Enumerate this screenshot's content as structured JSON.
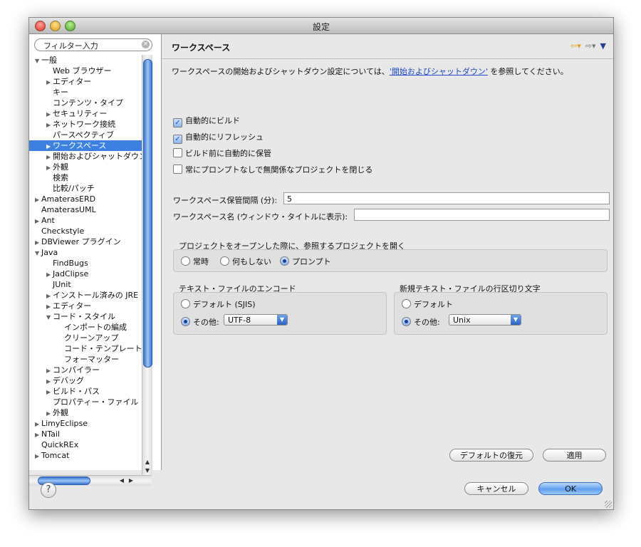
{
  "window": {
    "title": "設定"
  },
  "filter": {
    "placeholder": "フィルター入力"
  },
  "tree": [
    {
      "label": "一般",
      "indent": 0,
      "twisty": "open"
    },
    {
      "label": "Web ブラウザー",
      "indent": 1,
      "twisty": ""
    },
    {
      "label": "エディター",
      "indent": 1,
      "twisty": "closed"
    },
    {
      "label": "キー",
      "indent": 1,
      "twisty": ""
    },
    {
      "label": "コンテンツ・タイプ",
      "indent": 1,
      "twisty": ""
    },
    {
      "label": "セキュリティー",
      "indent": 1,
      "twisty": "closed"
    },
    {
      "label": "ネットワーク接続",
      "indent": 1,
      "twisty": "closed"
    },
    {
      "label": "パースペクティブ",
      "indent": 1,
      "twisty": ""
    },
    {
      "label": "ワークスペース",
      "indent": 1,
      "twisty": "closed",
      "selected": true
    },
    {
      "label": "開始およびシャットダウン",
      "indent": 1,
      "twisty": "closed"
    },
    {
      "label": "外観",
      "indent": 1,
      "twisty": "closed"
    },
    {
      "label": "検索",
      "indent": 1,
      "twisty": ""
    },
    {
      "label": "比較/パッチ",
      "indent": 1,
      "twisty": ""
    },
    {
      "label": "AmaterasERD",
      "indent": 0,
      "twisty": "closed"
    },
    {
      "label": "AmaterasUML",
      "indent": 0,
      "twisty": ""
    },
    {
      "label": "Ant",
      "indent": 0,
      "twisty": "closed"
    },
    {
      "label": "Checkstyle",
      "indent": 0,
      "twisty": ""
    },
    {
      "label": "DBViewer プラグイン",
      "indent": 0,
      "twisty": "closed"
    },
    {
      "label": "Java",
      "indent": 0,
      "twisty": "open"
    },
    {
      "label": "FindBugs",
      "indent": 1,
      "twisty": ""
    },
    {
      "label": "JadClipse",
      "indent": 1,
      "twisty": "closed"
    },
    {
      "label": "JUnit",
      "indent": 1,
      "twisty": ""
    },
    {
      "label": "インストール済みの JRE",
      "indent": 1,
      "twisty": "closed"
    },
    {
      "label": "エディター",
      "indent": 1,
      "twisty": "closed"
    },
    {
      "label": "コード・スタイル",
      "indent": 1,
      "twisty": "open"
    },
    {
      "label": "インポートの編成",
      "indent": 2,
      "twisty": ""
    },
    {
      "label": "クリーンアップ",
      "indent": 2,
      "twisty": ""
    },
    {
      "label": "コード・テンプレート",
      "indent": 2,
      "twisty": ""
    },
    {
      "label": "フォーマッター",
      "indent": 2,
      "twisty": ""
    },
    {
      "label": "コンパイラー",
      "indent": 1,
      "twisty": "closed"
    },
    {
      "label": "デバッグ",
      "indent": 1,
      "twisty": "closed"
    },
    {
      "label": "ビルド・パス",
      "indent": 1,
      "twisty": "closed"
    },
    {
      "label": "プロパティー・ファイル",
      "indent": 1,
      "twisty": ""
    },
    {
      "label": "外観",
      "indent": 1,
      "twisty": "closed"
    },
    {
      "label": "LimyEclipse",
      "indent": 0,
      "twisty": "closed"
    },
    {
      "label": "NTail",
      "indent": 0,
      "twisty": "closed"
    },
    {
      "label": "QuickREx",
      "indent": 0,
      "twisty": ""
    },
    {
      "label": "Tomcat",
      "indent": 0,
      "twisty": "closed"
    }
  ],
  "page": {
    "title": "ワークスペース",
    "desc_prefix": "ワークスペースの開始およびシャットダウン設定については、",
    "desc_link": "'開始およびシャットダウン'",
    "desc_suffix": " を参照してください。",
    "checks": [
      {
        "label": "自動的にビルド",
        "checked": true
      },
      {
        "label": "自動的にリフレッシュ",
        "checked": true
      },
      {
        "label": "ビルド前に自動的に保管",
        "checked": false
      },
      {
        "label": "常にプロンプトなしで無関係なプロジェクトを閉じる",
        "checked": false
      }
    ],
    "save_interval_label": "ワークスペース保管間隔 (分):",
    "save_interval_value": "5",
    "workspace_name_label": "ワークスペース名 (ウィンドウ・タイトルに表示):",
    "workspace_name_value": "",
    "open_ref": {
      "title": "プロジェクトをオープンした際に、参照するプロジェクトを開く",
      "options": [
        "常時",
        "何もしない",
        "プロンプト"
      ],
      "selected": "プロンプト"
    },
    "encoding": {
      "title": "テキスト・ファイルのエンコード",
      "default_label": "デフォルト (SJIS)",
      "other_label": "その他:",
      "other_value": "UTF-8",
      "selected": "その他:"
    },
    "line_delim": {
      "title": "新規テキスト・ファイルの行区切り文字",
      "default_label": "デフォルト",
      "other_label": "その他:",
      "other_value": "Unix",
      "selected": "その他:"
    },
    "restore_defaults": "デフォルトの復元",
    "apply": "適用"
  },
  "footer": {
    "cancel": "キャンセル",
    "ok": "OK"
  }
}
